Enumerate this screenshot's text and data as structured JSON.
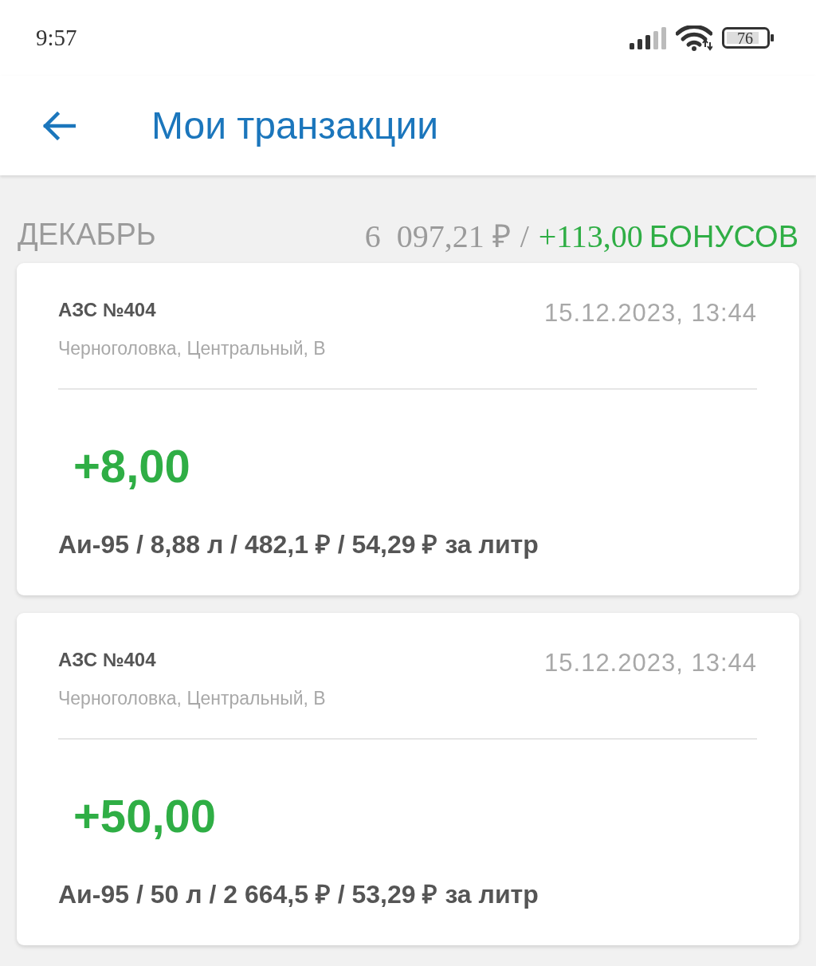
{
  "status_bar": {
    "time": "9:57",
    "battery": "76"
  },
  "header": {
    "title": "Мои транзакции"
  },
  "month": {
    "name": "ДЕКАБРЬ",
    "total": "6  097,21 ₽",
    "separator": "/",
    "bonus": "+113,00",
    "bonus_unit": "БОНУСОВ"
  },
  "transactions": [
    {
      "station": "АЗС №404",
      "address": "Черноголовка, Центральный, В",
      "datetime": "15.12.2023, 13:44",
      "bonus": "+8,00",
      "details": "Аи-95 / 8,88 л / 482,1 ₽ / 54,29 ₽ за литр"
    },
    {
      "station": "АЗС №404",
      "address": "Черноголовка, Центральный, В",
      "datetime": "15.12.2023, 13:44",
      "bonus": "+50,00",
      "details": "Аи-95 / 50 л / 2 664,5 ₽ / 53,29 ₽ за литр"
    }
  ]
}
